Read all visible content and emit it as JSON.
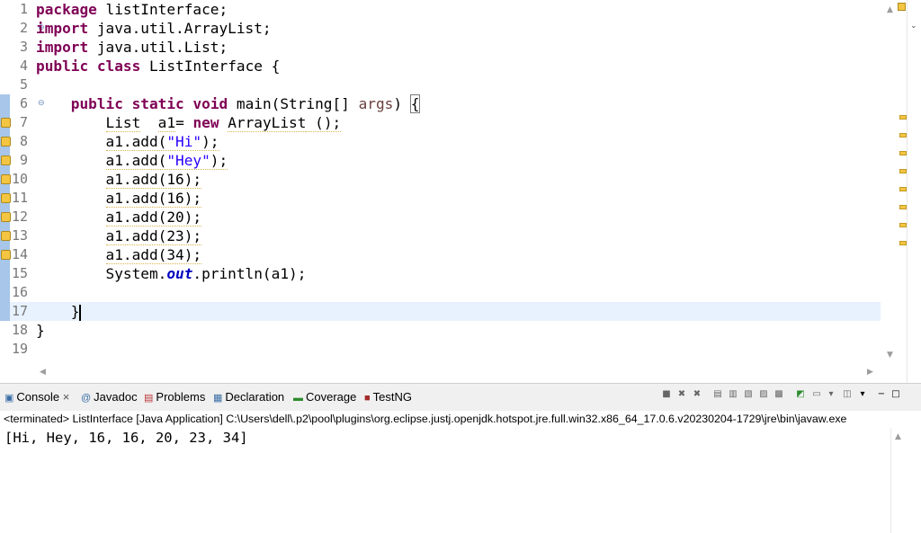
{
  "editor": {
    "line_numbers": [
      "1",
      "2",
      "3",
      "4",
      "5",
      "6",
      "7",
      "8",
      "9",
      "10",
      "11",
      "12",
      "13",
      "14",
      "15",
      "16",
      "17",
      "18",
      "19"
    ],
    "code": {
      "l1_kw": "package",
      "l1_rest": " listInterface;",
      "l2_kw": "import",
      "l2_rest": " java.util.ArrayList;",
      "l3_kw": "import",
      "l3_rest": " java.util.List;",
      "l4_kw1": "public",
      "l4_kw2": "class",
      "l4_rest": " ListInterface {",
      "l6_kw1": "public",
      "l6_kw2": "static",
      "l6_kw3": "void",
      "l6_mid": " main(String[] ",
      "l6_param": "args",
      "l6_close": ")",
      "l6_brace": "{",
      "l7_type": "List",
      "l7_var": "a1",
      "l7_eq": "= ",
      "l7_new": "new",
      "l7_sp": " ",
      "l7_cls": "ArrayList",
      "l7_rest": " ();",
      "l8_call": "a1.add(",
      "l8_str": "\"Hi\"",
      "l8_end": ");",
      "l9_call": "a1.add(",
      "l9_str": "\"Hey\"",
      "l9_end": ");",
      "l10": "a1.add(16);",
      "l11": "a1.add(16);",
      "l12": "a1.add(20);",
      "l13": "a1.add(23);",
      "l14": "a1.add(34);",
      "l15_a": "System.",
      "l15_fld": "out",
      "l15_b": ".println(a1);",
      "l17": "}",
      "l18": "}"
    }
  },
  "console": {
    "tabs": [
      {
        "label": "Console",
        "icon": "console-icon"
      },
      {
        "label": "Javadoc",
        "icon": "javadoc-icon"
      },
      {
        "label": "Problems",
        "icon": "problems-icon"
      },
      {
        "label": "Declaration",
        "icon": "declaration-icon"
      },
      {
        "label": "Coverage",
        "icon": "coverage-icon"
      },
      {
        "label": "TestNG",
        "icon": "testng-icon"
      }
    ],
    "close_glyph": "×",
    "status": "<terminated> ListInterface [Java Application] C:\\Users\\dell\\.p2\\pool\\plugins\\org.eclipse.justj.openjdk.hotspot.jre.full.win32.x86_64_17.0.6.v20230204-1729\\jre\\bin\\javaw.exe",
    "output": "[Hi, Hey, 16, 16, 20, 23, 34]"
  },
  "colors": {
    "keyword": "#7f0055",
    "string": "#2a00ff",
    "current_line": "#e8f2fe",
    "warning": "#f4c542",
    "range_indicator": "#a7c6ea"
  }
}
